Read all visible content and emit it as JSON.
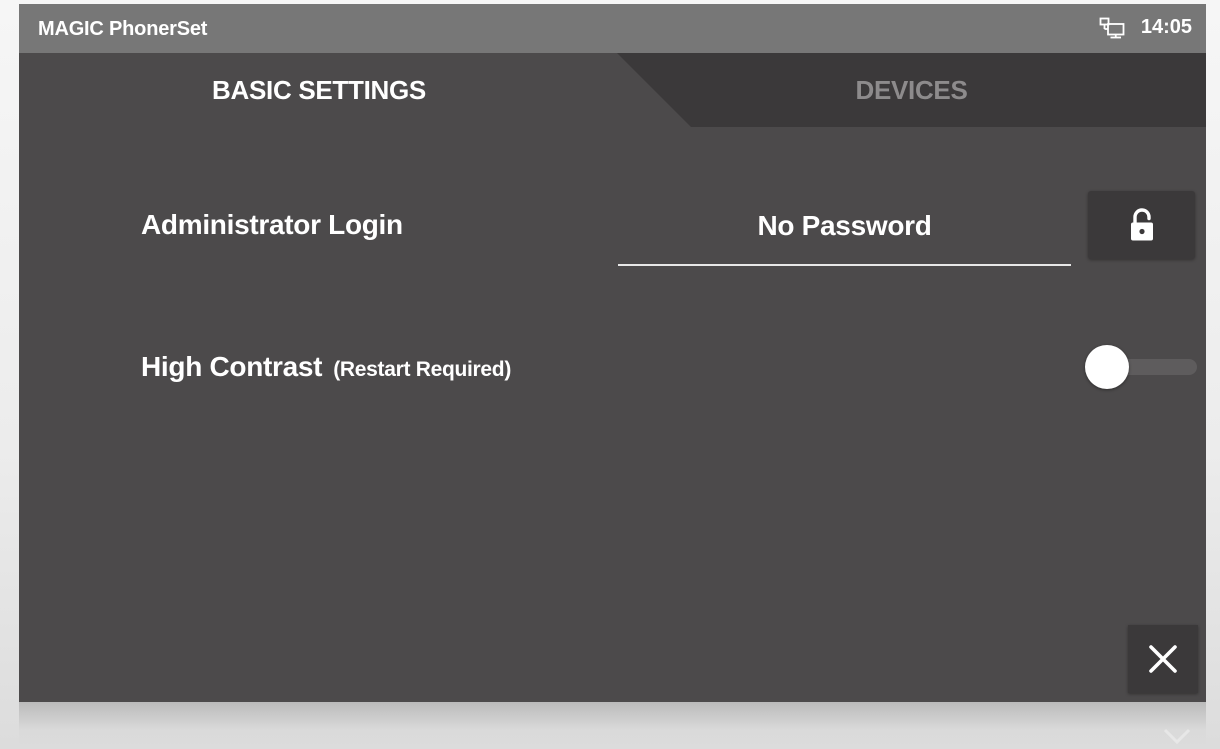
{
  "status_bar": {
    "app_title": "MAGIC PhonerSet",
    "network_icon": "network-computer-icon",
    "time": "14:05"
  },
  "tabs": [
    {
      "label": "BASIC SETTINGS",
      "active": true
    },
    {
      "label": "DEVICES",
      "active": false
    }
  ],
  "settings": {
    "admin_login": {
      "label": "Administrator Login",
      "value": "No Password",
      "button_icon": "lock-open-icon"
    },
    "high_contrast": {
      "label": "High Contrast",
      "note": "(Restart Required)",
      "enabled": false
    }
  },
  "footer": {
    "close_icon": "close-icon"
  },
  "colors": {
    "background": "#4c4a4b",
    "status_bar": "#777777",
    "inactive_tab": "#3b393a",
    "button": "#3b393a",
    "text": "#ffffff",
    "inactive_tab_text": "#8d8b8c"
  }
}
